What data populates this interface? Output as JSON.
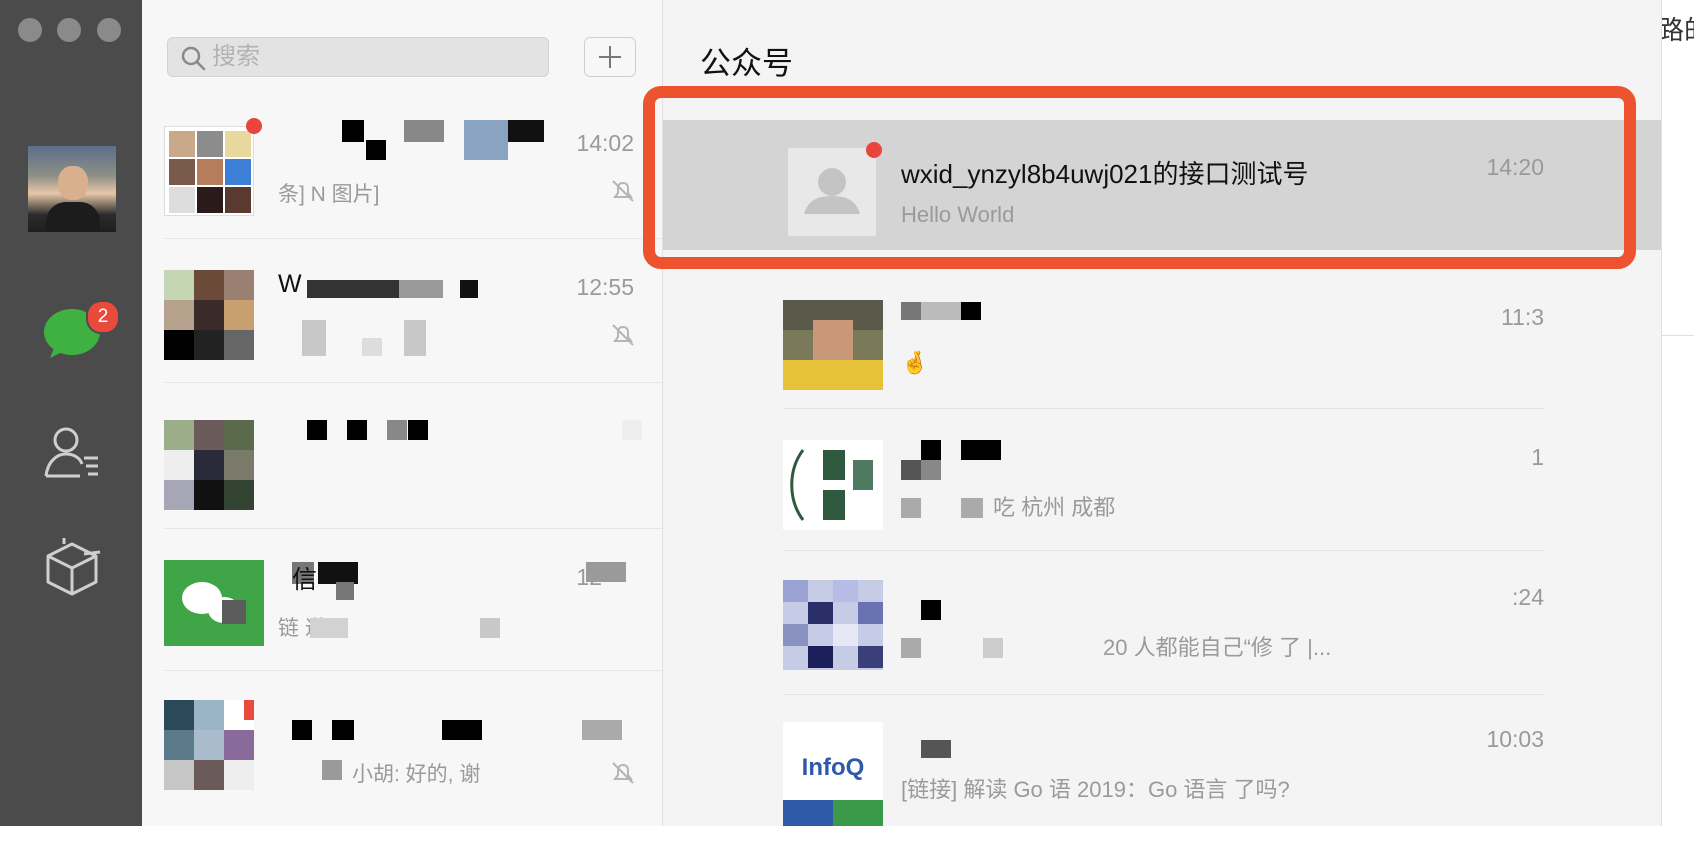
{
  "sidebar": {
    "chat_badge": "2",
    "nav_icons": [
      "chat-icon",
      "contacts-icon",
      "favorites-box-icon"
    ]
  },
  "search": {
    "placeholder": "搜索"
  },
  "conversations": [
    {
      "title": "",
      "time": "14:02",
      "preview": "条] N 图片]",
      "muted": true
    },
    {
      "title": "W",
      "time": "12:55",
      "preview": "",
      "muted": true
    },
    {
      "title": "",
      "time": "",
      "preview": "",
      "muted": false
    },
    {
      "title": "信",
      "time": "12",
      "preview": "链 递",
      "muted": false
    },
    {
      "title": "",
      "time": "",
      "preview": "小胡: 好的, 谢",
      "muted": true
    }
  ],
  "main": {
    "title": "公众号",
    "accounts": [
      {
        "name": "wxid_ynzyl8b4uwj021的接口测试号",
        "time": "14:20",
        "preview": "Hello World",
        "selected": true,
        "unread": true
      },
      {
        "name": "",
        "time": "11:3",
        "preview": "🤞",
        "selected": false,
        "unread": false
      },
      {
        "name": "",
        "time": "1",
        "preview": "吃 杭州 成都",
        "selected": false,
        "unread": false
      },
      {
        "name": "",
        "time": ":24",
        "preview": "20 人都能自己“修 了 |...",
        "selected": false,
        "unread": false
      },
      {
        "name": "",
        "time": "10:03",
        "preview": "[链接] 解读 Go 语 2019：Go 语言 了吗?",
        "selected": false,
        "unread": false,
        "avatar_text": "InfoQ"
      }
    ]
  },
  "right_edge": {
    "text": "路的"
  },
  "colors": {
    "highlight_frame": "#ee5330",
    "unread_dot": "#e8453c",
    "wechat_green": "#3fb143"
  }
}
